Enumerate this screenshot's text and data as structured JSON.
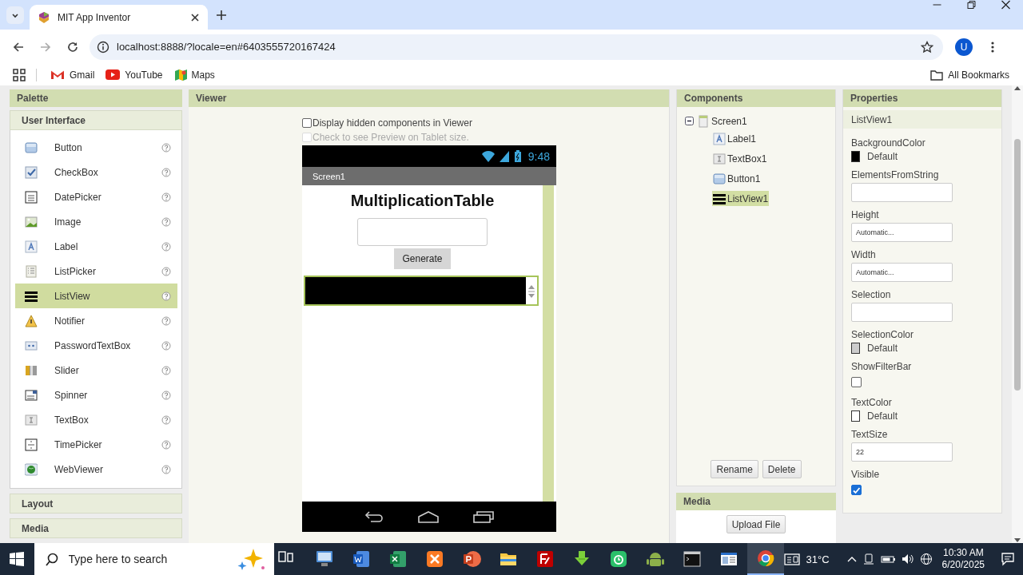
{
  "browser": {
    "tabs": [
      {
        "title": "MIT App Inventor",
        "selected": true
      }
    ],
    "url": "localhost:8888/?locale=en#6403555720167424",
    "profile": "U",
    "bookmarks": [
      {
        "label": "Gmail",
        "kind": "mail"
      },
      {
        "label": "YouTube",
        "kind": "video"
      },
      {
        "label": "Maps",
        "kind": "map"
      }
    ],
    "all_bookmarks": "All Bookmarks"
  },
  "palette": {
    "title": "Palette",
    "categories": [
      {
        "label": "User Interface",
        "items": [
          {
            "label": "Button",
            "kind": "button",
            "selected": false
          },
          {
            "label": "CheckBox",
            "kind": "checkbox",
            "selected": false
          },
          {
            "label": "DatePicker",
            "kind": "datepicker",
            "selected": false
          },
          {
            "label": "Image",
            "kind": "image",
            "selected": false
          },
          {
            "label": "Label",
            "kind": "label",
            "selected": false
          },
          {
            "label": "ListPicker",
            "kind": "listpicker",
            "selected": false
          },
          {
            "label": "ListView",
            "kind": "listview",
            "selected": true
          },
          {
            "label": "Notifier",
            "kind": "notifier",
            "selected": false
          },
          {
            "label": "PasswordTextBox",
            "kind": "password",
            "selected": false
          },
          {
            "label": "Slider",
            "kind": "slider",
            "selected": false
          },
          {
            "label": "Spinner",
            "kind": "spinner",
            "selected": false
          },
          {
            "label": "TextBox",
            "kind": "textbox",
            "selected": false
          },
          {
            "label": "TimePicker",
            "kind": "timepicker",
            "selected": false
          },
          {
            "label": "WebViewer",
            "kind": "webviewer",
            "selected": false
          }
        ]
      },
      {
        "label": "Layout"
      },
      {
        "label": "Media"
      }
    ]
  },
  "viewer": {
    "title": "Viewer",
    "options": [
      {
        "label": "Display hidden components in Viewer",
        "checked": false,
        "disabled": false
      },
      {
        "label": "Check to see Preview on Tablet size.",
        "checked": false,
        "disabled": true
      }
    ],
    "phone": {
      "time": "9:48",
      "screen_title": "Screen1",
      "label": "MultiplicationTable",
      "button": "Generate",
      "listview_selected": true
    }
  },
  "components": {
    "title": "Components",
    "tree": [
      {
        "label": "Screen1",
        "kind": "screen",
        "expanded": true,
        "selected": false,
        "children": [
          {
            "label": "Label1",
            "kind": "label",
            "selected": false
          },
          {
            "label": "TextBox1",
            "kind": "textbox",
            "selected": false
          },
          {
            "label": "Button1",
            "kind": "button",
            "selected": false
          },
          {
            "label": "ListView1",
            "kind": "listview",
            "selected": true
          }
        ]
      }
    ],
    "buttons": [
      "Rename",
      "Delete"
    ]
  },
  "media": {
    "title": "Media",
    "button": "Upload File"
  },
  "properties": {
    "title": "Properties",
    "component": "ListView1",
    "items": [
      {
        "label": "BackgroundColor",
        "kind": "color",
        "color": "#000000",
        "value": "Default"
      },
      {
        "label": "ElementsFromString",
        "kind": "text"
      },
      {
        "label": "Height",
        "kind": "text",
        "value": "Automatic..."
      },
      {
        "label": "Width",
        "kind": "text",
        "value": "Automatic..."
      },
      {
        "label": "Selection",
        "kind": "text"
      },
      {
        "label": "SelectionColor",
        "kind": "color",
        "color": "#cccccc",
        "value": "Default"
      },
      {
        "label": "ShowFilterBar",
        "kind": "checkbox",
        "checked": false
      },
      {
        "label": "TextColor",
        "kind": "color",
        "color": "#ffffff",
        "value": "Default"
      },
      {
        "label": "TextSize",
        "kind": "text",
        "value": "22"
      },
      {
        "label": "Visible",
        "kind": "checkbox",
        "checked": true
      }
    ]
  },
  "taskbar": {
    "search_placeholder": "Type here to search",
    "temperature": "31°C",
    "time": "10:30 AM",
    "date": "6/20/2025",
    "apps": [
      {
        "kind": "taskview",
        "selected": false
      },
      {
        "kind": "monitor",
        "selected": false
      },
      {
        "kind": "doc",
        "selected": false
      },
      {
        "kind": "sheet",
        "selected": false
      },
      {
        "kind": "orange",
        "selected": false
      },
      {
        "kind": "slides",
        "selected": false
      },
      {
        "kind": "folder",
        "selected": false
      },
      {
        "kind": "ftp",
        "selected": false
      },
      {
        "kind": "download",
        "selected": false
      },
      {
        "kind": "green",
        "selected": false
      },
      {
        "kind": "robot",
        "selected": false
      },
      {
        "kind": "terminal",
        "selected": false
      },
      {
        "kind": "window",
        "selected": false
      },
      {
        "kind": "browser",
        "selected": true
      }
    ]
  }
}
